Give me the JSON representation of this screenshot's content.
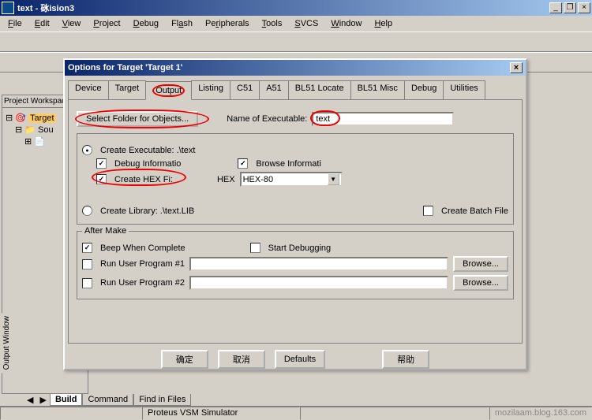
{
  "window": {
    "title": "text - 砯ision3"
  },
  "menu": {
    "file": "File",
    "edit": "Edit",
    "view": "View",
    "project": "Project",
    "debug": "Debug",
    "flash": "Flash",
    "peripherals": "Peripherals",
    "tools": "Tools",
    "svcs": "SVCS",
    "window": "Window",
    "help": "Help"
  },
  "workspace": {
    "title": "Project Workspace",
    "root": "Target",
    "child1": "Sou",
    "child2": ""
  },
  "dialog": {
    "title": "Options for Target 'Target 1'",
    "tabs": {
      "device": "Device",
      "target": "Target",
      "output": "Output",
      "listing": "Listing",
      "c51": "C51",
      "a51": "A51",
      "bl51locate": "BL51 Locate",
      "bl51misc": "BL51 Misc",
      "debug": "Debug",
      "utilities": "Utilities"
    },
    "select_folder": "Select Folder for Objects...",
    "name_label": "Name of Executable:",
    "name_value": "text",
    "create_exe": "Create Executable:  .\\text",
    "debug_info": "Debug Informatio",
    "browse_info": "Browse Informati",
    "create_hex": "Create HEX Fi:",
    "hex_label": "HEX",
    "hex_value": "HEX-80",
    "create_lib": "Create Library:  .\\text.LIB",
    "create_batch": "Create Batch File",
    "after_make": "After Make",
    "beep": "Beep When Complete",
    "start_debug": "Start Debugging",
    "run1": "Run User Program #1",
    "run2": "Run User Program #2",
    "browse": "Browse...",
    "ok": "确定",
    "cancel": "取消",
    "defaults": "Defaults",
    "help": "帮助"
  },
  "output_tabs": {
    "build": "Build",
    "command": "Command",
    "find": "Find in Files"
  },
  "status": {
    "sim": "Proteus VSM Simulator",
    "watermark": "mozilaam.blog.163.com"
  }
}
